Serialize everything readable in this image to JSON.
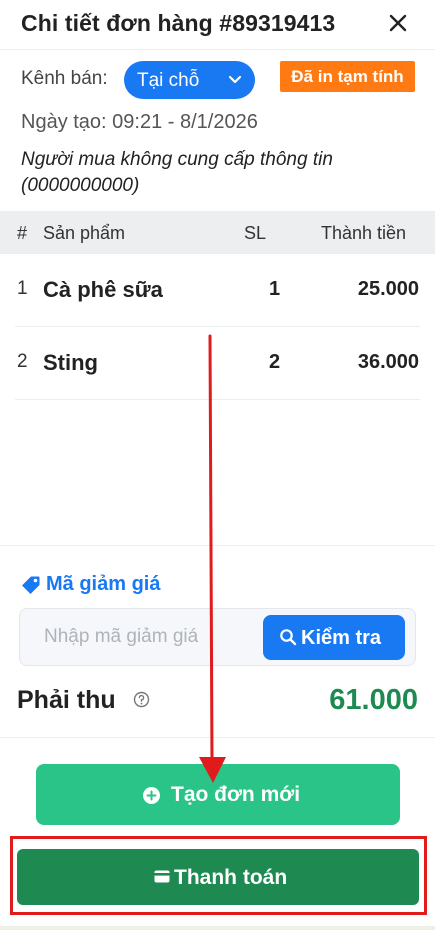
{
  "header": {
    "title": "Chi tiết đơn hàng #89319413"
  },
  "channel": {
    "label": "Kênh bán:",
    "value": "Tại chỗ"
  },
  "print_status": "Đã in tạm tính",
  "created": {
    "label": "Ngày tạo:",
    "value": "09:21 - 8/1/2026",
    "text": "Ngày tạo: 09:21 - 8/1/2026"
  },
  "buyer": "Người mua không cung cấp thông tin (0000000000)",
  "table": {
    "headers": {
      "index": "#",
      "product": "Sản phẩm",
      "qty": "SL",
      "total": "Thành tiền"
    },
    "rows": [
      {
        "index": "1",
        "name": "Cà phê sữa",
        "qty": "1",
        "total": "25.000"
      },
      {
        "index": "2",
        "name": "Sting",
        "qty": "2",
        "total": "36.000"
      }
    ]
  },
  "discount": {
    "label": "Mã giảm giá",
    "placeholder": "Nhập mã giảm giá",
    "check_label": "Kiểm tra"
  },
  "due": {
    "label": "Phải thu",
    "amount": "61.000"
  },
  "actions": {
    "new_order": "Tạo đơn mới",
    "pay": "Thanh toán"
  },
  "colors": {
    "primary_blue": "#1979f2",
    "badge_orange": "#ff7a12",
    "new_order_green": "#2bc488",
    "pay_green": "#1e8a52",
    "annotation_red": "#e01b1b"
  },
  "icons": [
    "close-icon",
    "chevron-down-icon",
    "tag-icon",
    "search-icon",
    "help-icon",
    "plus-circle-icon",
    "card-icon"
  ]
}
